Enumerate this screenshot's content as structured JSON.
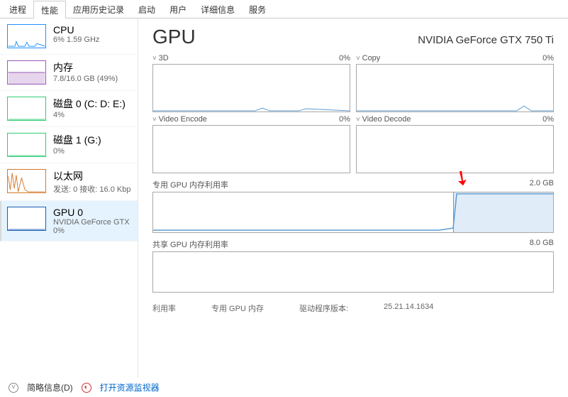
{
  "tabs": [
    "进程",
    "性能",
    "应用历史记录",
    "启动",
    "用户",
    "详细信息",
    "服务"
  ],
  "active_tab": 1,
  "sidebar": [
    {
      "title": "CPU",
      "sub": "6% 1.59 GHz",
      "kind": "cpu"
    },
    {
      "title": "内存",
      "sub": "7.8/16.0 GB (49%)",
      "kind": "mem"
    },
    {
      "title": "磁盘 0 (C: D: E:)",
      "sub": "4%",
      "kind": "disk"
    },
    {
      "title": "磁盘 1 (G:)",
      "sub": "0%",
      "kind": "disk"
    },
    {
      "title": "以太网",
      "sub": "发送: 0 接收: 16.0 Kbps",
      "kind": "eth"
    },
    {
      "title": "GPU 0",
      "sub": "NVIDIA GeForce GTX …\n0%",
      "kind": "gpu",
      "selected": true
    }
  ],
  "header": {
    "title": "GPU",
    "device": "NVIDIA GeForce GTX 750 Ti"
  },
  "small_charts": [
    {
      "label": "3D",
      "value": "0%"
    },
    {
      "label": "Copy",
      "value": "0%"
    },
    {
      "label": "Video Encode",
      "value": "0%"
    },
    {
      "label": "Video Decode",
      "value": "0%"
    }
  ],
  "wide_charts": [
    {
      "label": "专用 GPU 内存利用率",
      "value": "2.0 GB",
      "filled": true
    },
    {
      "label": "共享 GPU 内存利用率",
      "value": "8.0 GB",
      "filled": false
    }
  ],
  "stats": [
    {
      "label": "利用率"
    },
    {
      "label": "专用 GPU 内存"
    },
    {
      "label": "驱动程序版本:"
    },
    {
      "label": "25.21.14.1634"
    }
  ],
  "bottom": {
    "brief": "简略信息(D)",
    "monitor": "打开资源监视器"
  },
  "chart_data": {
    "type": "line",
    "note": "GPU utilization panels from Windows Task Manager Performance tab",
    "panels": [
      {
        "name": "3D",
        "unit": "%",
        "range": [
          0,
          100
        ],
        "series": [
          0,
          0,
          0,
          0,
          0,
          1,
          1,
          0,
          0,
          1,
          0,
          0
        ]
      },
      {
        "name": "Copy",
        "unit": "%",
        "range": [
          0,
          100
        ],
        "series": [
          0,
          0,
          0,
          0,
          0,
          0,
          0,
          0,
          0,
          2,
          0,
          0
        ]
      },
      {
        "name": "Video Encode",
        "unit": "%",
        "range": [
          0,
          100
        ],
        "series": [
          0,
          0,
          0,
          0,
          0,
          0,
          0,
          0,
          0,
          0,
          0,
          0
        ]
      },
      {
        "name": "Video Decode",
        "unit": "%",
        "range": [
          0,
          100
        ],
        "series": [
          0,
          0,
          0,
          0,
          0,
          0,
          0,
          0,
          0,
          0,
          0,
          0
        ]
      },
      {
        "name": "专用 GPU 内存利用率",
        "unit": "GB",
        "range": [
          0,
          2.0
        ],
        "series": [
          0.1,
          0.1,
          0.1,
          0.1,
          0.1,
          0.1,
          0.1,
          0.1,
          0.1,
          2.0,
          2.0,
          2.0
        ]
      },
      {
        "name": "共享 GPU 内存利用率",
        "unit": "GB",
        "range": [
          0,
          8.0
        ],
        "series": [
          0,
          0,
          0,
          0,
          0,
          0,
          0,
          0,
          0,
          0,
          0,
          0
        ]
      }
    ]
  }
}
